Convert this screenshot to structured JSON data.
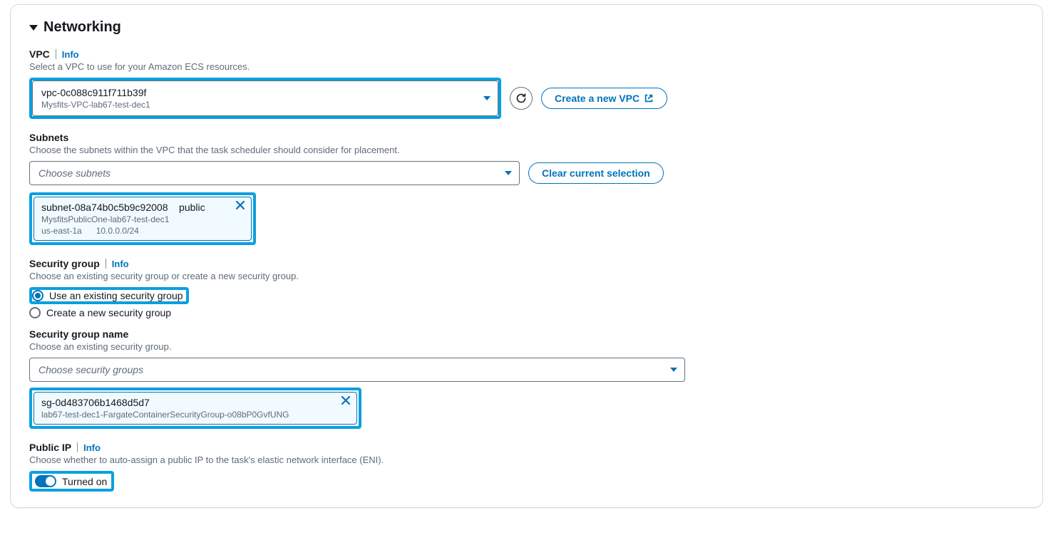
{
  "section": {
    "title": "Networking"
  },
  "vpc": {
    "label": "VPC",
    "info": "Info",
    "desc": "Select a VPC to use for your Amazon ECS resources.",
    "selected_id": "vpc-0c088c911f711b39f",
    "selected_name": "Mysfits-VPC-lab67-test-dec1",
    "create_label": "Create a new VPC"
  },
  "subnets": {
    "label": "Subnets",
    "desc": "Choose the subnets within the VPC that the task scheduler should consider for placement.",
    "placeholder": "Choose subnets",
    "clear_label": "Clear current selection",
    "chip": {
      "main": "subnet-08a74b0c5b9c92008    public",
      "line1": "MysfitsPublicOne-lab67-test-dec1",
      "line2": "us-east-1a      10.0.0.0/24"
    }
  },
  "sg": {
    "label": "Security group",
    "info": "Info",
    "desc": "Choose an existing security group or create a new security group.",
    "opt_existing": "Use an existing security group",
    "opt_create": "Create a new security group"
  },
  "sgname": {
    "label": "Security group name",
    "desc": "Choose an existing security group.",
    "placeholder": "Choose security groups",
    "chip": {
      "main": "sg-0d483706b1468d5d7",
      "sub": "lab67-test-dec1-FargateContainerSecurityGroup-o08bP0GvfUNG"
    }
  },
  "publicip": {
    "label": "Public IP",
    "info": "Info",
    "desc": "Choose whether to auto-assign a public IP to the task's elastic network interface (ENI).",
    "state": "Turned on"
  }
}
